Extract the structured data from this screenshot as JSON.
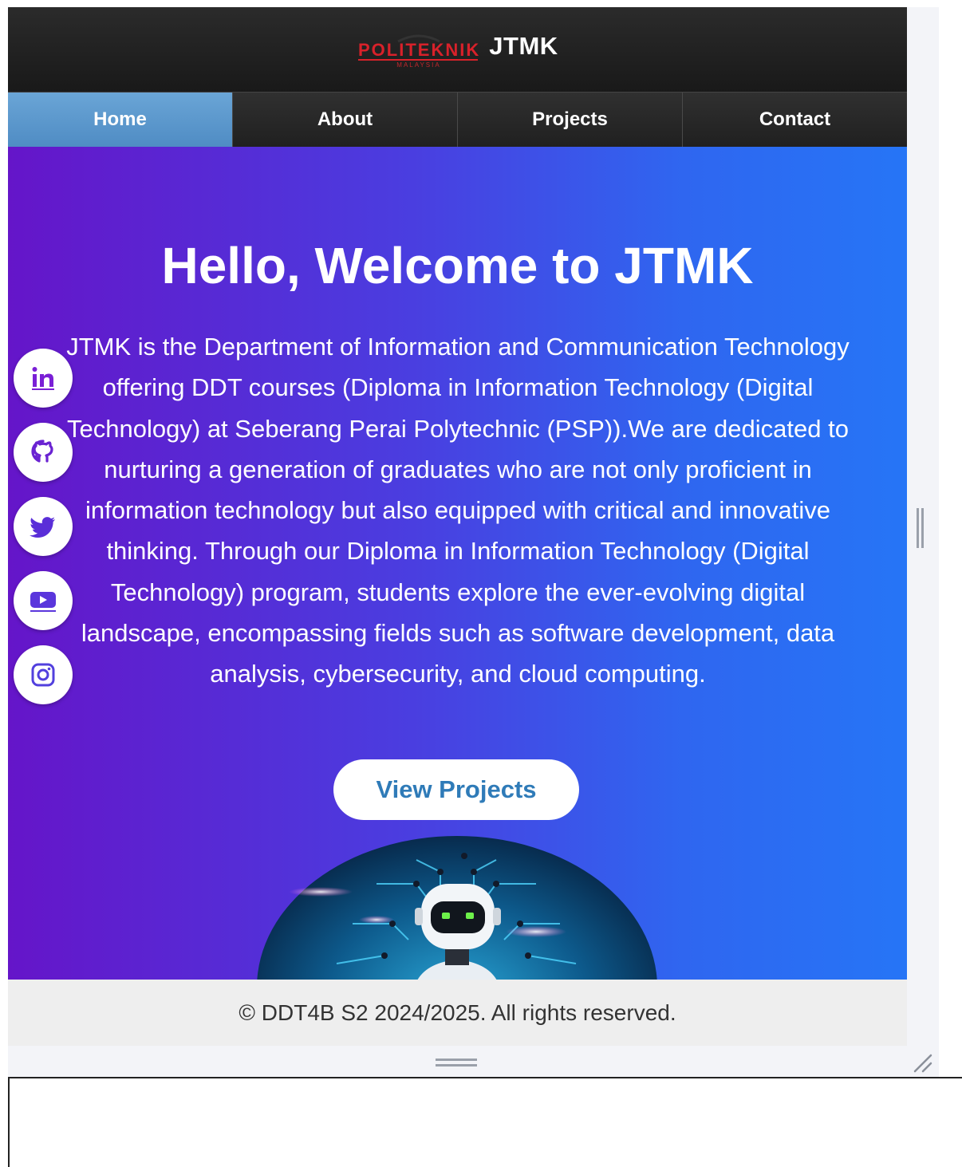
{
  "header": {
    "logo_text": "POLITEKNIK",
    "logo_subtext": "MALAYSIA",
    "title": "JTMK"
  },
  "nav": {
    "items": [
      {
        "label": "Home",
        "active": true
      },
      {
        "label": "About",
        "active": false
      },
      {
        "label": "Projects",
        "active": false
      },
      {
        "label": "Contact",
        "active": false
      }
    ]
  },
  "hero": {
    "heading": "Hello, Welcome to JTMK",
    "description": "JTMK is the Department of Information and Communication Technology offering DDT courses (Diploma in Information Technology (Digital Technology) at Seberang Perai Polytechnic (PSP)).We are dedicated to nurturing a generation of graduates who are not only proficient in information technology but also equipped with critical and innovative thinking. Through our Diploma in Information Technology (Digital Technology) program, students explore the ever-evolving digital landscape, encompassing fields such as software development, data analysis, cybersecurity, and cloud computing.",
    "cta_label": "View Projects"
  },
  "socials": [
    {
      "icon": "linkedin-icon"
    },
    {
      "icon": "github-icon"
    },
    {
      "icon": "twitter-icon"
    },
    {
      "icon": "youtube-icon"
    },
    {
      "icon": "instagram-icon"
    }
  ],
  "footer": {
    "text": "© DDT4B S2 2024/2025. All rights reserved."
  },
  "colors": {
    "gradient_start": "#6515c9",
    "gradient_end": "#2675f6",
    "nav_active": "#5b97cc",
    "cta_text": "#2f7bb8",
    "logo_red": "#d8212a"
  }
}
